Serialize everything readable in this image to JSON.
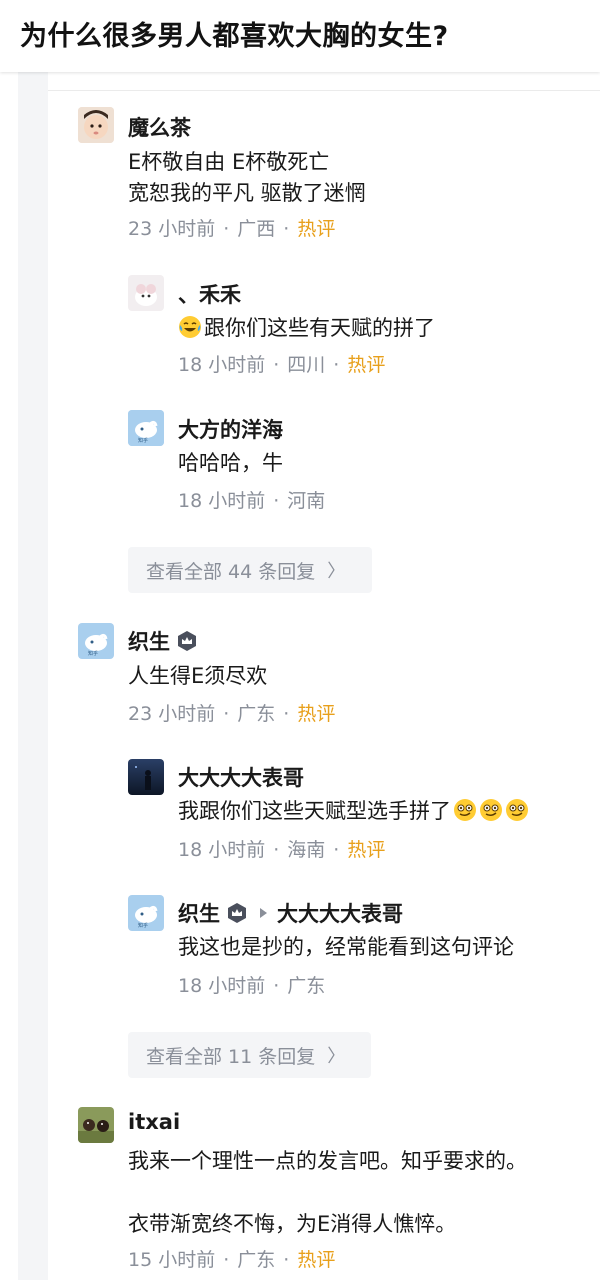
{
  "question": {
    "title": "为什么很多男人都喜欢大胸的女生?"
  },
  "comments": [
    {
      "author": "魔么茶",
      "lines": [
        "E杯敬自由 E杯敬死亡",
        "宽恕我的平凡 驱散了迷惘"
      ],
      "time": "23 小时前",
      "sep": "·",
      "region": "广西",
      "tag": "热评"
    },
    {
      "author": "、禾禾",
      "text": "跟你们这些有天赋的拼了",
      "time": "18 小时前",
      "sep": "·",
      "region": "四川",
      "tag": "热评"
    },
    {
      "author": "大方的洋海",
      "text": "哈哈哈，牛",
      "time": "18 小时前",
      "sep": "·",
      "region": "河南"
    },
    {
      "view_all": "查看全部 44 条回复",
      "chevron": "〉"
    },
    {
      "author": "织生",
      "text": "人生得E须尽欢",
      "time": "23 小时前",
      "sep": "·",
      "region": "广东",
      "tag": "热评"
    },
    {
      "author": "大大大大表哥",
      "text": "我跟你们这些天赋型选手拼了",
      "time": "18 小时前",
      "sep": "·",
      "region": "海南",
      "tag": "热评"
    },
    {
      "author": "织生",
      "reply_to": "大大大大表哥",
      "text": "我这也是抄的，经常能看到这句评论",
      "time": "18 小时前",
      "sep": "·",
      "region": "广东"
    },
    {
      "view_all": "查看全部 11 条回复",
      "chevron": "〉"
    },
    {
      "author": "itxai",
      "lines": [
        "我来一个理性一点的发言吧。知乎要求的。",
        "",
        "衣带渐宽终不悔，为E消得人憔悴。"
      ],
      "time": "15 小时前",
      "sep": "·",
      "region": "广东",
      "tag": "热评"
    }
  ],
  "colors": {
    "hot": "#e8a01c",
    "meta": "#8a8f99",
    "badge": "#4a4f5c"
  },
  "icons": {
    "badge": "crown-badge-icon",
    "emoji_cry_laugh": "tears-of-joy-emoji",
    "emoji_drool": "drooling-face-emoji",
    "reply_arrow": "triangle-right-icon"
  }
}
